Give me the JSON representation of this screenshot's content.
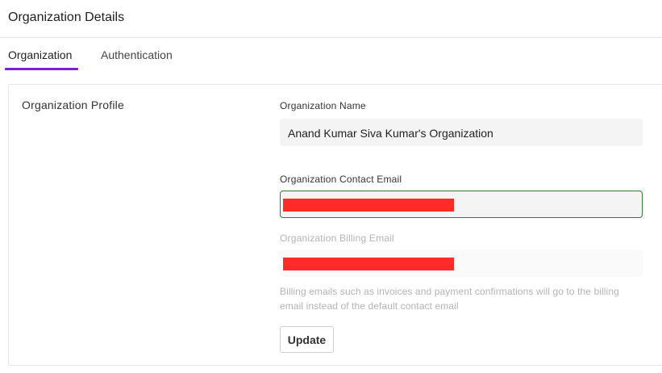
{
  "header": {
    "title": "Organization Details"
  },
  "tabs": [
    {
      "label": "Organization",
      "active": true
    },
    {
      "label": "Authentication",
      "active": false
    }
  ],
  "accent_color": "#7b1fd1",
  "focus_color": "#2e7d32",
  "profile": {
    "section_title": "Organization Profile",
    "name_label": "Organization Name",
    "name_value": "Anand Kumar Siva Kumar's Organization",
    "contact_email_label": "Organization Contact Email",
    "contact_email_value": "[redacted]",
    "billing_email_label": "Organization Billing Email",
    "billing_email_value": "[redacted]",
    "billing_helper": "Billing emails such as invoices and payment confirmations will go to the billing email instead of the default contact email",
    "update_label": "Update"
  }
}
